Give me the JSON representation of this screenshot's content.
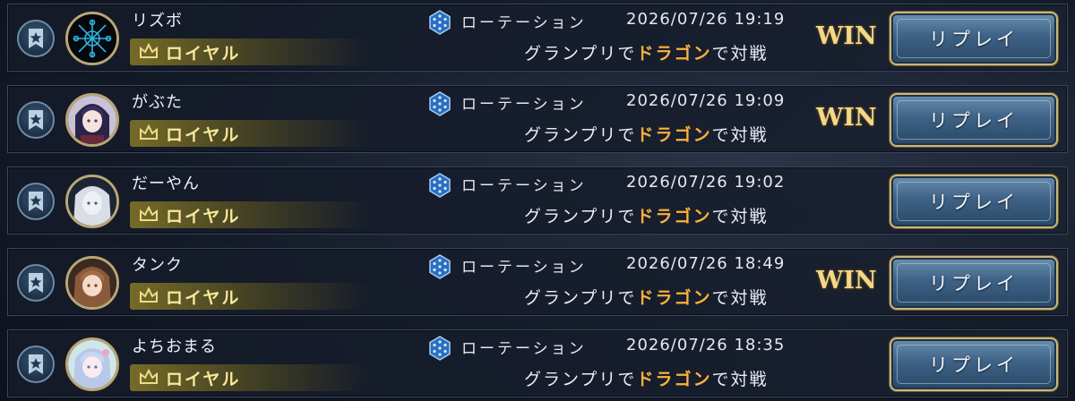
{
  "colors": {
    "accent_gold": "#cbb77a",
    "highlight_orange": "#ffb13b",
    "class_text": "#f6e79a",
    "win_text": "#f3d88a"
  },
  "icons": {
    "favorite": "bookmark-star-icon",
    "class": "crown-icon",
    "format": "rotation-hexagon-icon"
  },
  "matches": [
    {
      "player": "リズボ",
      "class": "ロイヤル",
      "format": "ローテーション",
      "datetime": "2026/07/26 19:19",
      "desc_prefix": "グランプリで",
      "opponent_class": "ドラゴン",
      "desc_suffix": "で対戦",
      "result": "WIN",
      "replay_label": "リプレイ",
      "avatar_icon": "snowflake-emblem-avatar"
    },
    {
      "player": "がぶた",
      "class": "ロイヤル",
      "format": "ローテーション",
      "datetime": "2026/07/26 19:09",
      "desc_prefix": "グランプリで",
      "opponent_class": "ドラゴン",
      "desc_suffix": "で対戦",
      "result": "WIN",
      "replay_label": "リプレイ",
      "avatar_icon": "dark-haired-girl-avatar"
    },
    {
      "player": "だーやん",
      "class": "ロイヤル",
      "format": "ローテーション",
      "datetime": "2026/07/26 19:02",
      "desc_prefix": "グランプリで",
      "opponent_class": "ドラゴン",
      "desc_suffix": "で対戦",
      "result": "",
      "replay_label": "リプレイ",
      "avatar_icon": "silver-haired-girl-avatar"
    },
    {
      "player": "タンク",
      "class": "ロイヤル",
      "format": "ローテーション",
      "datetime": "2026/07/26 18:49",
      "desc_prefix": "グランプリで",
      "opponent_class": "ドラゴン",
      "desc_suffix": "で対戦",
      "result": "WIN",
      "replay_label": "リプレイ",
      "avatar_icon": "brown-haired-girl-avatar"
    },
    {
      "player": "よちおまる",
      "class": "ロイヤル",
      "format": "ローテーション",
      "datetime": "2026/07/26 18:35",
      "desc_prefix": "グランプリで",
      "opponent_class": "ドラゴン",
      "desc_suffix": "で対戦",
      "result": "",
      "replay_label": "リプレイ",
      "avatar_icon": "pastel-haired-girl-avatar"
    }
  ]
}
